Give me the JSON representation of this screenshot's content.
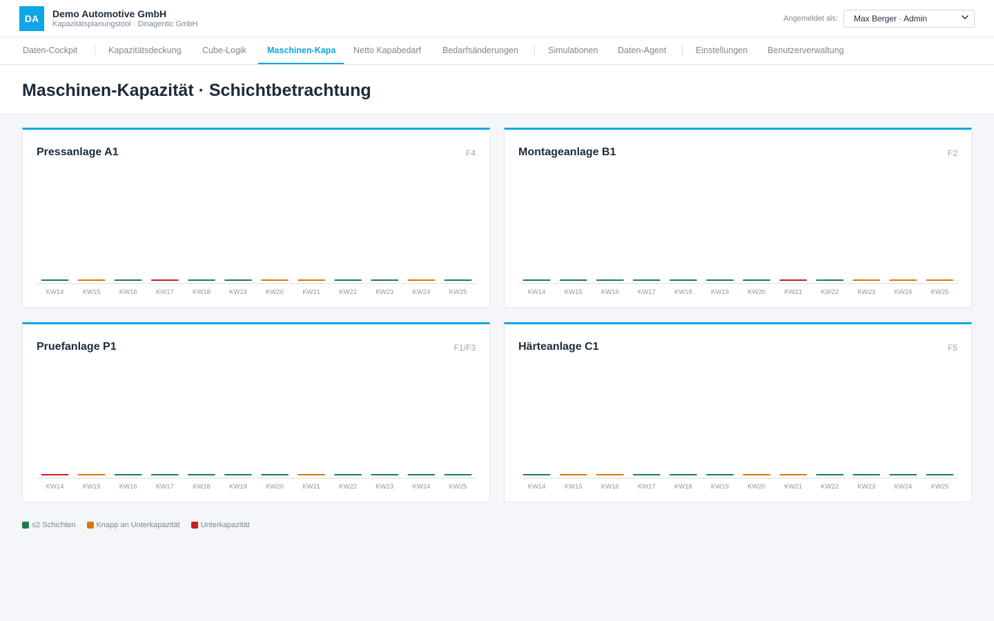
{
  "header": {
    "logo_text": "DA",
    "company": "Demo Automotive GmbH",
    "subtitle": "Kapazitätsplanungstool · Dinagentic GmbH",
    "login_label": "Angemeldet als:",
    "user_value": "Max Berger · Admin"
  },
  "nav": {
    "tabs": [
      {
        "label": "Daten-Cockpit"
      },
      {
        "label": "Kapazitätsdeckung"
      },
      {
        "label": "Cube-Logik"
      },
      {
        "label": "Maschinen-Kapa",
        "active": true
      },
      {
        "label": "Netto Kapabedarf"
      },
      {
        "label": "Bedarfsänderungen"
      },
      {
        "label": "Simulationen"
      },
      {
        "label": "Daten-Agent"
      },
      {
        "label": "Einstellungen"
      },
      {
        "label": "Benutzerverwaltung"
      }
    ]
  },
  "page_title": "Maschinen-Kapazität · Schichtbetrachtung",
  "colors": {
    "accent": "#0ea5e9",
    "green": "#1e7d45",
    "orange": "#d97706",
    "red": "#c81e1e"
  },
  "legend": [
    {
      "label": "≤2 Schichten",
      "status": "green"
    },
    {
      "label": "Knapp an Unterkapazität",
      "status": "orange"
    },
    {
      "label": "Unterkapazität",
      "status": "red"
    }
  ],
  "chart_data": [
    {
      "type": "bar",
      "title": "Pressanlage A1",
      "tag": "F4",
      "categories": [
        "KW14",
        "KW15",
        "KW16",
        "KW17",
        "KW18",
        "KW19",
        "KW20",
        "KW21",
        "KW22",
        "KW23",
        "KW24",
        "KW25"
      ],
      "status": [
        "green",
        "orange",
        "green",
        "red",
        "green",
        "green",
        "orange",
        "orange",
        "green",
        "green",
        "orange",
        "green"
      ]
    },
    {
      "type": "bar",
      "title": "Montageanlage B1",
      "tag": "F2",
      "categories": [
        "KW14",
        "KW15",
        "KW16",
        "KW17",
        "KW18",
        "KW19",
        "KW20",
        "KW21",
        "KW22",
        "KW23",
        "KW24",
        "KW25"
      ],
      "status": [
        "green",
        "green",
        "green",
        "green",
        "green",
        "green",
        "green",
        "red",
        "green",
        "orange",
        "orange",
        "orange"
      ]
    },
    {
      "type": "bar",
      "title": "Pruefanlage P1",
      "tag": "F1/F3",
      "categories": [
        "KW14",
        "KW15",
        "KW16",
        "KW17",
        "KW18",
        "KW19",
        "KW20",
        "KW21",
        "KW22",
        "KW23",
        "KW24",
        "KW25"
      ],
      "status": [
        "red",
        "orange",
        "green",
        "green",
        "green",
        "green",
        "green",
        "orange",
        "green",
        "green",
        "green",
        "green"
      ]
    },
    {
      "type": "bar",
      "title": "Härteanlage C1",
      "tag": "F5",
      "categories": [
        "KW14",
        "KW15",
        "KW16",
        "KW17",
        "KW18",
        "KW19",
        "KW20",
        "KW21",
        "KW22",
        "KW23",
        "KW24",
        "KW25"
      ],
      "status": [
        "green",
        "orange",
        "orange",
        "green",
        "green",
        "green",
        "orange",
        "orange",
        "green",
        "green",
        "green",
        "green"
      ]
    }
  ]
}
